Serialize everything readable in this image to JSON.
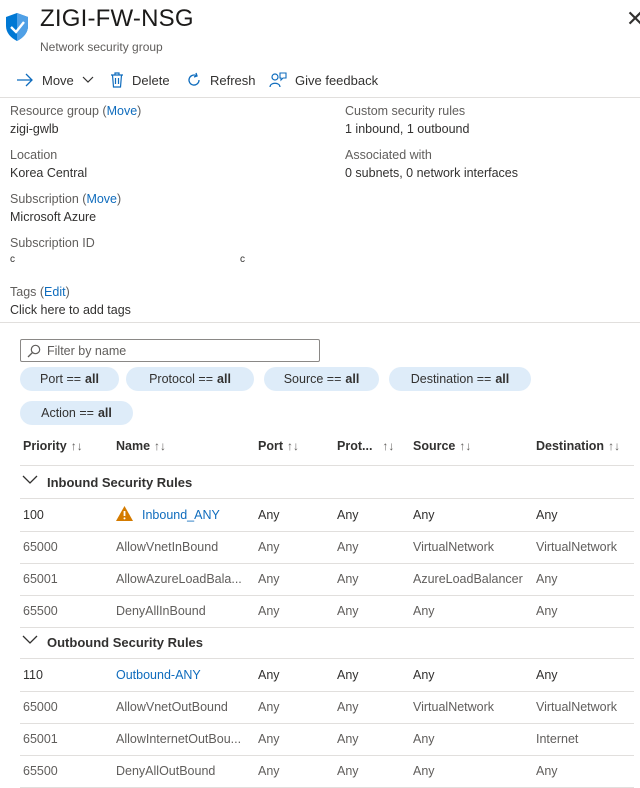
{
  "header": {
    "title": "ZIGI-FW-NSG",
    "subtitle": "Network security group",
    "close_glyph": "✕"
  },
  "toolbar": {
    "move_label": "Move",
    "delete_label": "Delete",
    "refresh_label": "Refresh",
    "feedback_label": "Give feedback"
  },
  "essentials": {
    "resource_group_label": "Resource group",
    "resource_group_action": "Move",
    "resource_group_value": "zigi-gwlb",
    "location_label": "Location",
    "location_value": "Korea Central",
    "subscription_label": "Subscription",
    "subscription_action": "Move",
    "subscription_value": "Microsoft Azure",
    "subscription_id_label": "Subscription ID",
    "subscription_id_start": "c",
    "subscription_id_end": "c",
    "custom_rules_label": "Custom security rules",
    "custom_rules_value": "1 inbound, 1 outbound",
    "associated_label": "Associated with",
    "associated_value": "0 subnets, 0 network interfaces",
    "tags_label": "Tags",
    "tags_action": "Edit",
    "tags_value": "Click here to add tags"
  },
  "filter": {
    "placeholder": "Filter by name",
    "pills": [
      {
        "label": "Port ==",
        "value": "all"
      },
      {
        "label": "Protocol ==",
        "value": "all"
      },
      {
        "label": "Source ==",
        "value": "all"
      },
      {
        "label": "Destination ==",
        "value": "all"
      },
      {
        "label": "Action ==",
        "value": "all"
      }
    ]
  },
  "table": {
    "columns": [
      "Priority",
      "Name",
      "Port",
      "Prot...",
      "Source",
      "Destination"
    ],
    "sort_glyph": "↑↓",
    "inbound_group": "Inbound Security Rules",
    "outbound_group": "Outbound Security Rules",
    "inbound": [
      {
        "priority": "100",
        "name": "Inbound_ANY",
        "port": "Any",
        "protocol": "Any",
        "source": "Any",
        "destination": "Any"
      },
      {
        "priority": "65000",
        "name": "AllowVnetInBound",
        "port": "Any",
        "protocol": "Any",
        "source": "VirtualNetwork",
        "destination": "VirtualNetwork"
      },
      {
        "priority": "65001",
        "name": "AllowAzureLoadBala...",
        "port": "Any",
        "protocol": "Any",
        "source": "AzureLoadBalancer",
        "destination": "Any"
      },
      {
        "priority": "65500",
        "name": "DenyAllInBound",
        "port": "Any",
        "protocol": "Any",
        "source": "Any",
        "destination": "Any"
      }
    ],
    "outbound": [
      {
        "priority": "110",
        "name": "Outbound-ANY",
        "port": "Any",
        "protocol": "Any",
        "source": "Any",
        "destination": "Any"
      },
      {
        "priority": "65000",
        "name": "AllowVnetOutBound",
        "port": "Any",
        "protocol": "Any",
        "source": "VirtualNetwork",
        "destination": "VirtualNetwork"
      },
      {
        "priority": "65001",
        "name": "AllowInternetOutBou...",
        "port": "Any",
        "protocol": "Any",
        "source": "Any",
        "destination": "Internet"
      },
      {
        "priority": "65500",
        "name": "DenyAllOutBound",
        "port": "Any",
        "protocol": "Any",
        "source": "Any",
        "destination": "Any"
      }
    ]
  },
  "colors": {
    "link": "#0f6cbd",
    "pill_bg": "#deecf9",
    "warning": "#d47b00",
    "shield": "#0078d4"
  }
}
